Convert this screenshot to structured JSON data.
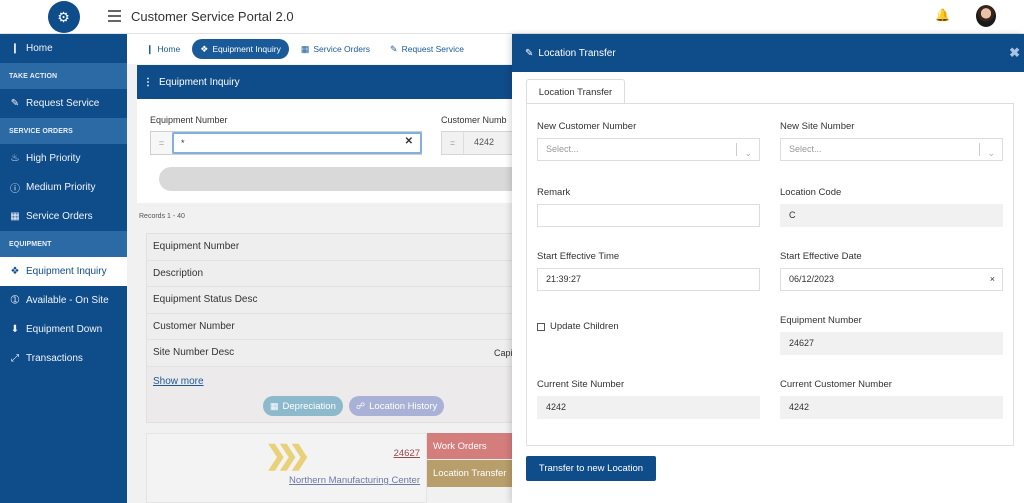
{
  "topbar": {
    "title": "Customer Service Portal 2.0"
  },
  "sidebar": {
    "items": [
      {
        "type": "item",
        "icon": "bar-chart-icon",
        "glyph": "❙",
        "label": "Home"
      },
      {
        "type": "section",
        "label": "TAKE ACTION"
      },
      {
        "type": "item",
        "icon": "pencil-icon",
        "glyph": "✎",
        "label": "Request Service"
      },
      {
        "type": "section",
        "label": "SERVICE ORDERS"
      },
      {
        "type": "item",
        "icon": "fire-icon",
        "glyph": "♨",
        "label": "High Priority"
      },
      {
        "type": "item",
        "icon": "info-circle-icon",
        "glyph": "ⓘ",
        "label": "Medium Priority"
      },
      {
        "type": "item",
        "icon": "grid-icon",
        "glyph": "▦",
        "label": "Service Orders"
      },
      {
        "type": "section",
        "label": "EQUIPMENT"
      },
      {
        "type": "item",
        "icon": "layers-icon",
        "glyph": "❖",
        "label": "Equipment Inquiry",
        "active": true
      },
      {
        "type": "item",
        "icon": "arrow-circle-icon",
        "glyph": "➀",
        "label": "Available - On Site"
      },
      {
        "type": "item",
        "icon": "arrow-down-circle-icon",
        "glyph": "⬇",
        "label": "Equipment Down"
      },
      {
        "type": "item",
        "icon": "expand-icon",
        "glyph": "⤢",
        "label": "Transactions"
      }
    ]
  },
  "tabs": [
    {
      "icon": "bar-chart-icon",
      "glyph": "❙",
      "label": "Home"
    },
    {
      "icon": "layers-icon",
      "glyph": "❖",
      "label": "Equipment Inquiry",
      "active": true
    },
    {
      "icon": "grid-icon",
      "glyph": "▦",
      "label": "Service Orders"
    },
    {
      "icon": "pencil-icon",
      "glyph": "✎",
      "label": "Request Service"
    }
  ],
  "inquiry": {
    "header": "Equipment Inquiry",
    "equipment_label": "Equipment Number",
    "equipment_op": "=",
    "equipment_value": "*",
    "customer_label": "Customer Numb",
    "customer_op": "=",
    "customer_value": "4242"
  },
  "records": "Records  1 - 40",
  "details": {
    "rows": [
      {
        "label": "Equipment Number",
        "value": ""
      },
      {
        "label": "Description",
        "value": ""
      },
      {
        "label": "Equipment Status Desc",
        "value": ""
      },
      {
        "label": "Customer Number",
        "value": ""
      },
      {
        "label": "Site Number Desc",
        "value": "Capi"
      }
    ],
    "show_more": "Show more",
    "depreciation": "Depreciation",
    "location_history": "Location History"
  },
  "card": {
    "equipment": "24627",
    "site": "Northern Manufacturing Center",
    "work_orders": "Work Orders",
    "location_transfer": "Location Transfer"
  },
  "modal": {
    "title": "Location Transfer",
    "tab": "Location Transfer",
    "new_customer_label": "New Customer Number",
    "new_customer_placeholder": "Select...",
    "new_site_label": "New Site Number",
    "new_site_placeholder": "Select...",
    "remark_label": "Remark",
    "remark_value": "",
    "location_code_label": "Location Code",
    "location_code_value": "C",
    "start_time_label": "Start Effective Time",
    "start_time_value": "21:39:27",
    "start_date_label": "Start Effective Date",
    "start_date_value": "06/12/2023",
    "update_children_label": "Update Children",
    "update_children_checked": false,
    "equipment_number_label": "Equipment Number",
    "equipment_number_value": "24627",
    "current_site_label": "Current Site Number",
    "current_site_value": "4242",
    "current_customer_label": "Current Customer Number",
    "current_customer_value": "4242",
    "submit_label": "Transfer to new Location"
  },
  "colors": {
    "primary": "#0f4c8a",
    "section": "#2c6aa6",
    "work_orders": "#d47d7d",
    "location_transfer": "#b79e6a"
  }
}
